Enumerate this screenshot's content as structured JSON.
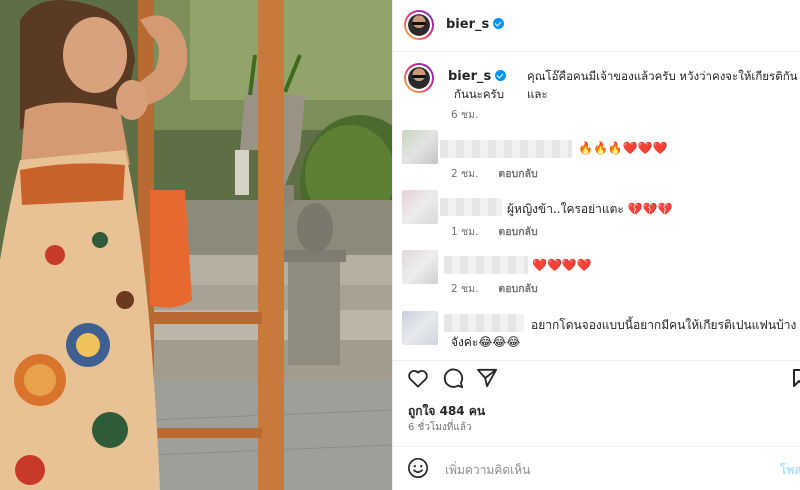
{
  "post": {
    "username": "bier_s",
    "verified": true
  },
  "caption": {
    "username": "bier_s",
    "text_line1": "คุณโอ๊คือคนมีเจ้าของแล้วครับ หวังว่าคงจะให้เกียรติกันและ",
    "text_line2": "กันนะครับ",
    "time": "6 ชม."
  },
  "comments": [
    {
      "text": "🔥🔥🔥❤️❤️❤️",
      "time": "2 ชม.",
      "reply_label": "ตอบกลับ"
    },
    {
      "text": "ผู้หญิงข้า..ใครอย่าแตะ 💔💔💔",
      "time": "1 ชม.",
      "reply_label": "ตอบกลับ"
    },
    {
      "text": "❤️❤️❤️❤️",
      "time": "2 ชม.",
      "reply_label": "ตอบกลับ"
    },
    {
      "text_line1": "อยากโดนจองแบบนี้อยากมีคนให้เกียรติเปนแฟนบ้าง",
      "text_line2": "จังค่ะ😂😂😂"
    }
  ],
  "stats": {
    "likes": "ถูกใจ 484 คน",
    "time_ago": "6 ชั่วโมงที่แล้ว"
  },
  "composer": {
    "placeholder": "เพิ่มความคิดเห็น",
    "post_label": "โพสต์"
  },
  "icons": {
    "like": "heart-icon",
    "comment": "comment-icon",
    "share": "send-icon",
    "save": "bookmark-icon",
    "emoji": "emoji-icon",
    "verified": "verified-badge-icon"
  },
  "colors": {
    "verified_blue": "#0095f6",
    "text_primary": "#262626",
    "text_secondary": "#737373",
    "post_button_disabled": "#b2dffc"
  }
}
